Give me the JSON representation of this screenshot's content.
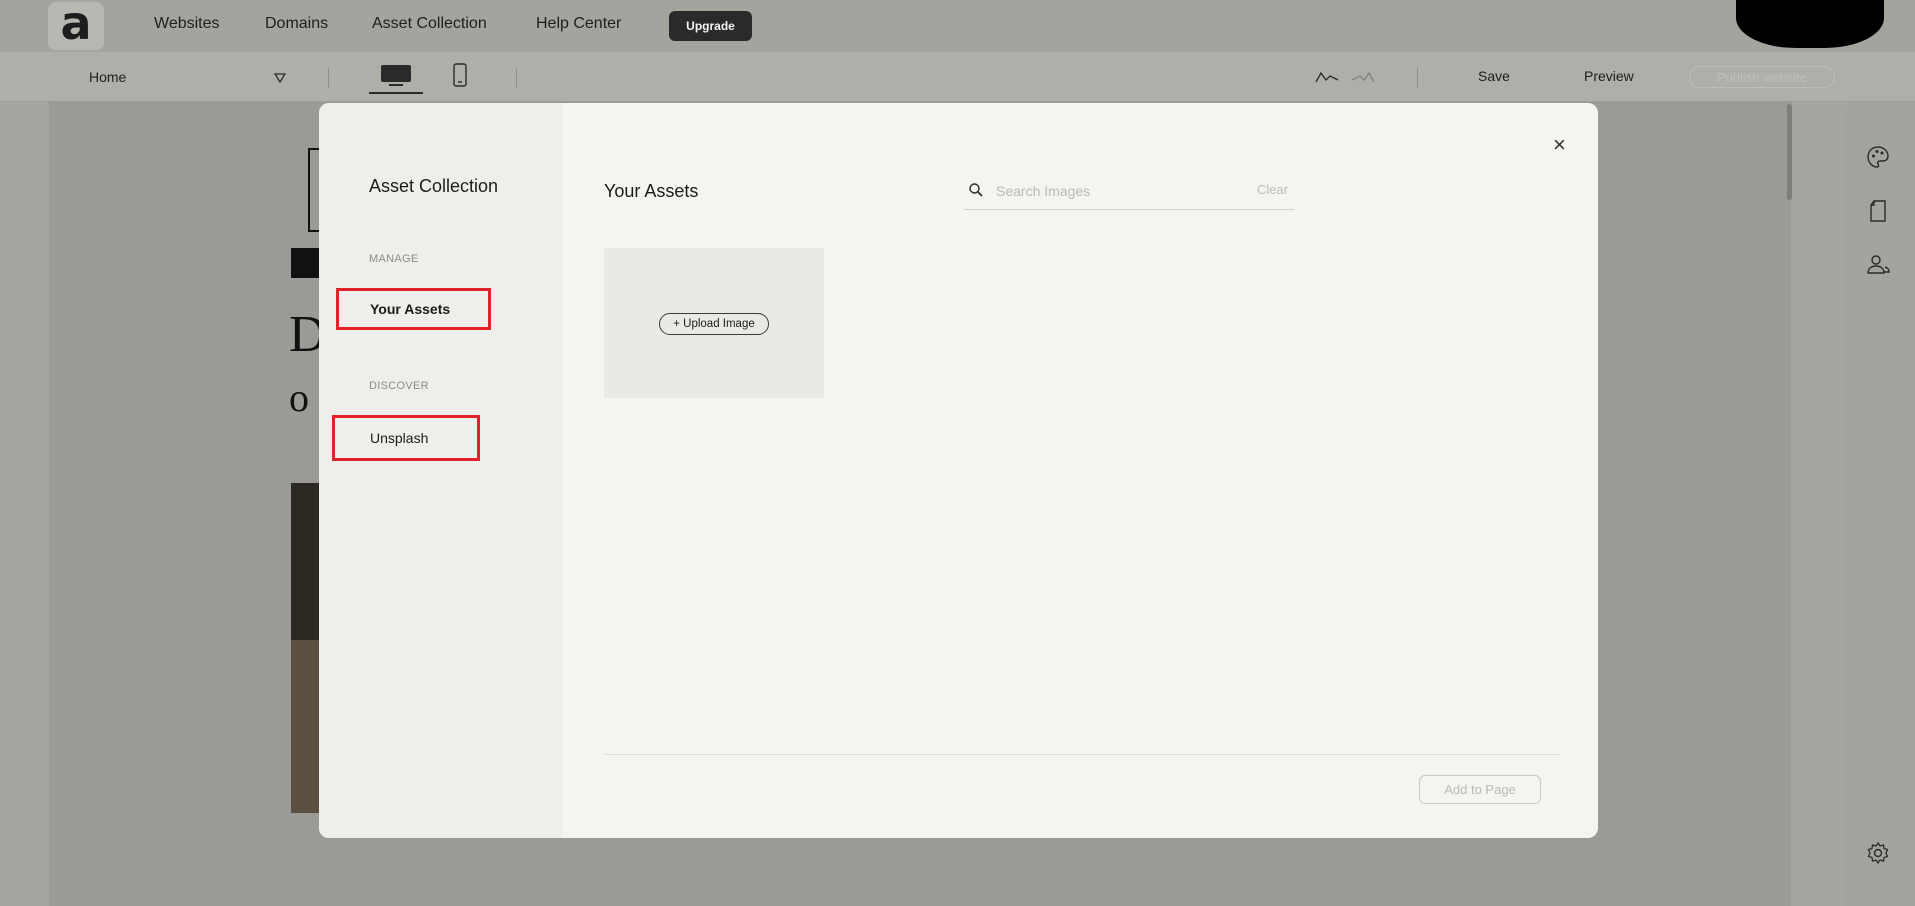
{
  "topnav": {
    "logo_glyph": "a",
    "links": [
      "Websites",
      "Domains",
      "Asset Collection",
      "Help Center"
    ],
    "upgrade_label": "Upgrade"
  },
  "toolbar": {
    "page_select": "Home",
    "save_label": "Save",
    "preview_label": "Preview",
    "publish_label": "Publish website"
  },
  "background": {
    "letters": [
      "D",
      "o"
    ]
  },
  "modal": {
    "title": "Asset Collection",
    "sections": {
      "manage": "MANAGE",
      "discover": "DISCOVER"
    },
    "items": {
      "your_assets": "Your Assets",
      "unsplash": "Unsplash"
    },
    "heading": "Your Assets",
    "search": {
      "placeholder": "Search Images",
      "clear_label": "Clear"
    },
    "close_glyph": "×",
    "upload_label": "+ Upload Image",
    "add_label": "Add to Page"
  },
  "colors": {
    "highlight": "#e0222b",
    "upgrade_bg": "#2a2a2a"
  },
  "icons": [
    "search-icon",
    "close-icon",
    "undo-icon",
    "redo-icon",
    "desktop-icon",
    "mobile-icon",
    "palette-icon",
    "page-icon",
    "users-icon",
    "gear-icon",
    "chevron-down-icon"
  ]
}
